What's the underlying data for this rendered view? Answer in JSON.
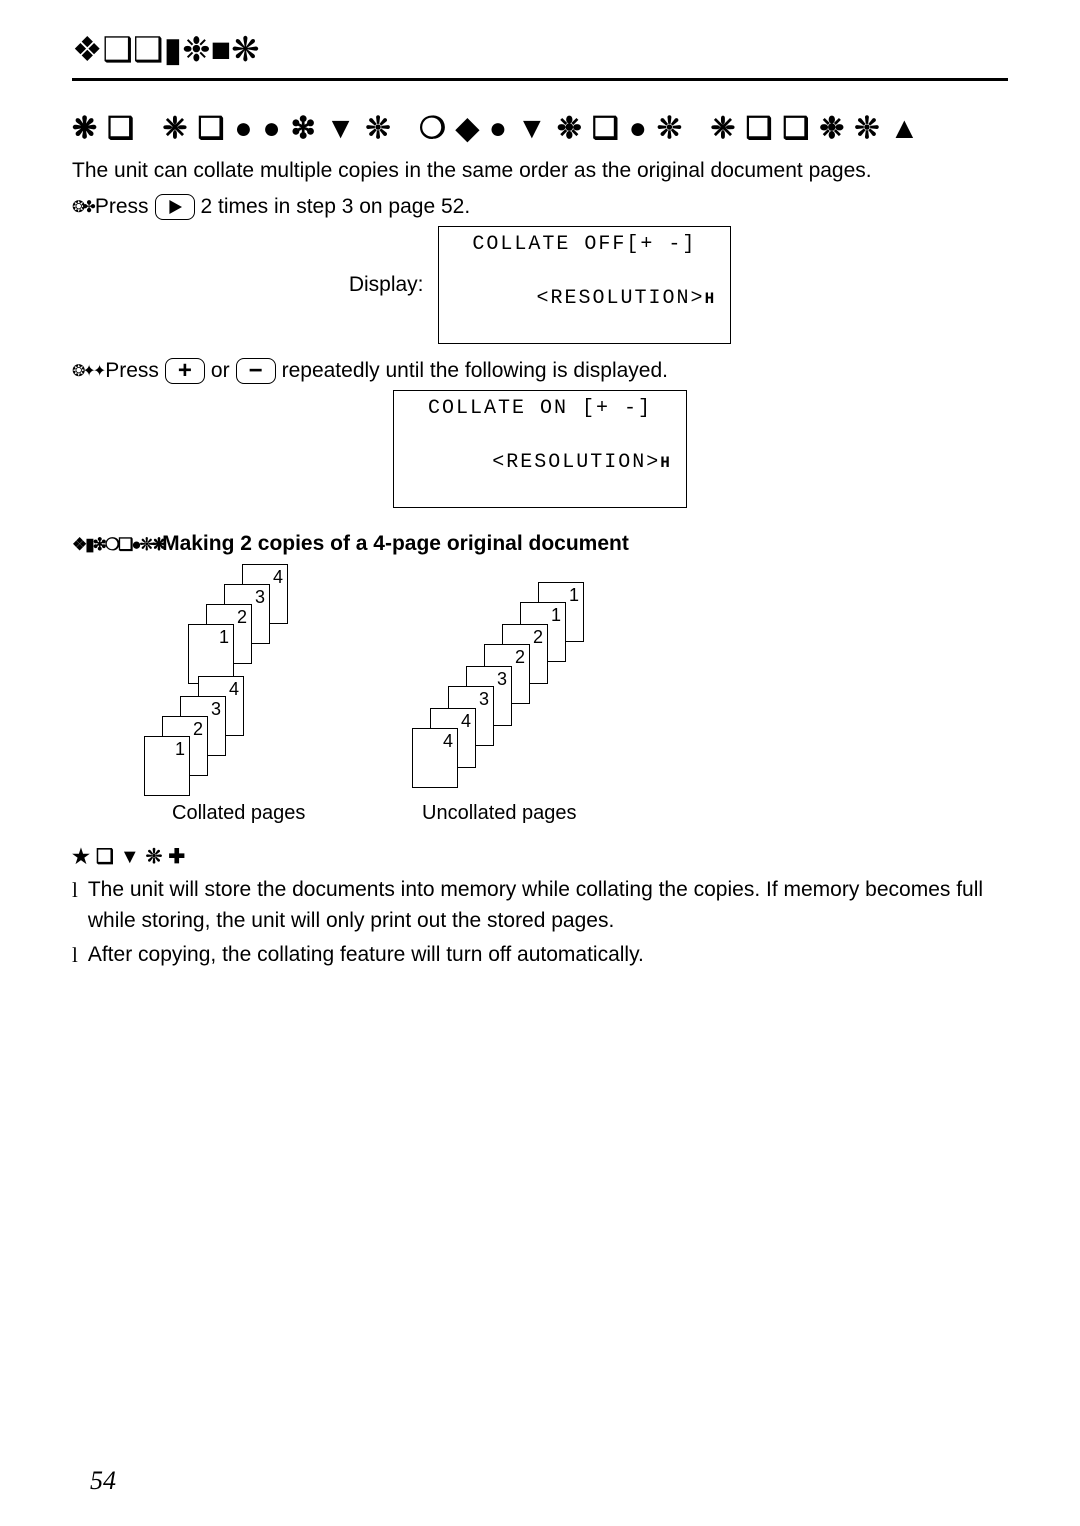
{
  "header_symbol_run": "❖❑❑▮❉■❋",
  "section_title_run": "❋❑ ❈❑●●❇▼❊ ❍◆●▼❉❑●❊ ❈❑❑❉❊▲",
  "intro": "The unit can collate multiple copies in the same order as the original document pages.",
  "step1": {
    "bullet": "❂✤",
    "press": "Press",
    "times_text": "2 times in step 3 on page 52."
  },
  "display_label": "Display:",
  "lcd1_line1": "COLLATE OFF[+ -]",
  "lcd1_line2": "<RESOLUTION>",
  "step2": {
    "bullet": "❂✦✦",
    "press": "Press",
    "or": "or",
    "after": "repeatedly until the following is displayed."
  },
  "lcd2_line1": "COLLATE ON [+ -]",
  "lcd2_line2": "<RESOLUTION>",
  "example": {
    "prefix": "❖▮❇❍❑●❊❋",
    "text": "Making 2 copies of a 4-page original document"
  },
  "diagram": {
    "collated_label": "Collated pages",
    "uncollated_label": "Uncollated pages",
    "collated_stacks": [
      {
        "pages": [
          "4",
          "3",
          "2",
          "1"
        ]
      },
      {
        "pages": [
          "4",
          "3",
          "2",
          "1"
        ]
      }
    ],
    "uncollated_stacks": [
      {
        "pages": [
          "1",
          "1",
          "2",
          "2",
          "3",
          "3",
          "4",
          "4"
        ]
      }
    ]
  },
  "notes_head": "★❑▼❊✚",
  "notes": [
    "The unit will store the documents into memory while collating the copies. If memory becomes full while storing, the unit will only print out the stored pages.",
    "After copying, the collating feature will turn off automatically."
  ],
  "page_number": "54"
}
